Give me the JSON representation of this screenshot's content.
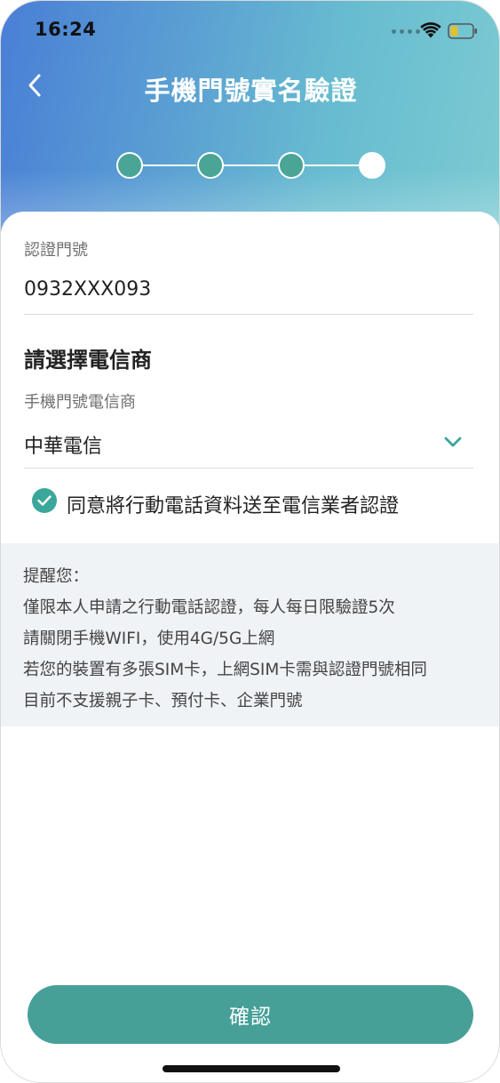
{
  "status_bar": {
    "time": "16:24"
  },
  "header": {
    "title": "手機門號實名驗證"
  },
  "stepper": {
    "total_steps": 4,
    "current_step": 4
  },
  "form": {
    "phone_label": "認證門號",
    "phone_value": "0932XXX093",
    "carrier_section_title": "請選擇電信商",
    "carrier_label": "手機門號電信商",
    "carrier_selected": "中華電信",
    "consent_checked": true,
    "consent_text": "同意將行動電話資料送至電信業者認證"
  },
  "notice": {
    "title": "提醒您：",
    "lines": [
      "僅限本人申請之行動電話認證，每人每日限驗證5次",
      "請關閉手機WIFI，使用4G/5G上網",
      "若您的裝置有多張SIM卡，上網SIM卡需與認證門號相同",
      "目前不支援親子卡、預付卡、企業門號"
    ]
  },
  "actions": {
    "confirm_label": "確認"
  },
  "colors": {
    "accent": "#46a098",
    "step_done": "#4aa597",
    "header_start": "#4a7fd6",
    "header_end": "#7ccbd3"
  }
}
